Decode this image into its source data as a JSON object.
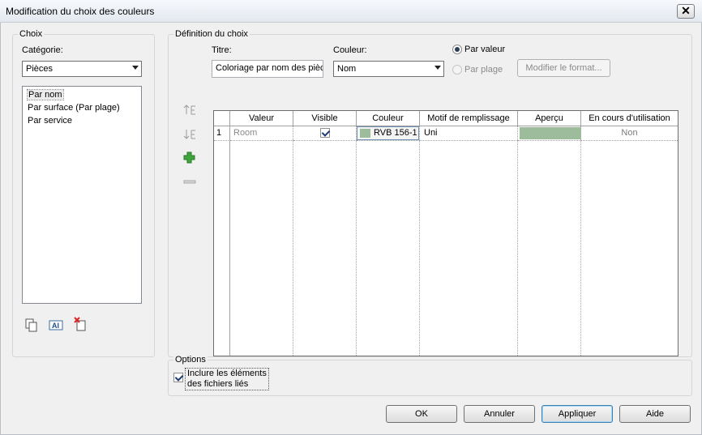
{
  "window": {
    "title": "Modification du choix des couleurs",
    "close_glyph": "✕"
  },
  "choix": {
    "legend": "Choix",
    "category_label": "Catégorie:",
    "category_value": "Pièces",
    "list": [
      "Par nom",
      "Par surface (Par plage)",
      "Par service"
    ],
    "icons": [
      "duplicate-icon",
      "rename-icon",
      "delete-icon"
    ]
  },
  "definition": {
    "legend": "Définition du choix",
    "titre_label": "Titre:",
    "titre_value": "Coloriage par nom des pièc",
    "couleur_label": "Couleur:",
    "couleur_value": "Nom",
    "radio_par_valeur": "Par valeur",
    "radio_par_plage": "Par plage",
    "modifier_format": "Modifier le format...",
    "grid": {
      "headers": [
        "Valeur",
        "Visible",
        "Couleur",
        "Motif de remplissage",
        "Aperçu",
        "En cours d'utilisation"
      ],
      "rows": [
        {
          "num": "1",
          "valeur": "Room",
          "visible": true,
          "couleur": "RVB 156-1",
          "swatch": "#9cbc9c",
          "motif": "Uni",
          "apercu": "#9cbc9c",
          "usage": "Non"
        }
      ]
    },
    "side_buttons": [
      "move-up-icon",
      "move-down-icon",
      "add-icon",
      "remove-icon"
    ]
  },
  "options": {
    "legend": "Options",
    "include_label_line1": "Inclure les éléments",
    "include_label_line2": "des fichiers liés",
    "include_checked": true
  },
  "buttons": {
    "ok": "OK",
    "annuler": "Annuler",
    "appliquer": "Appliquer",
    "aide": "Aide"
  }
}
